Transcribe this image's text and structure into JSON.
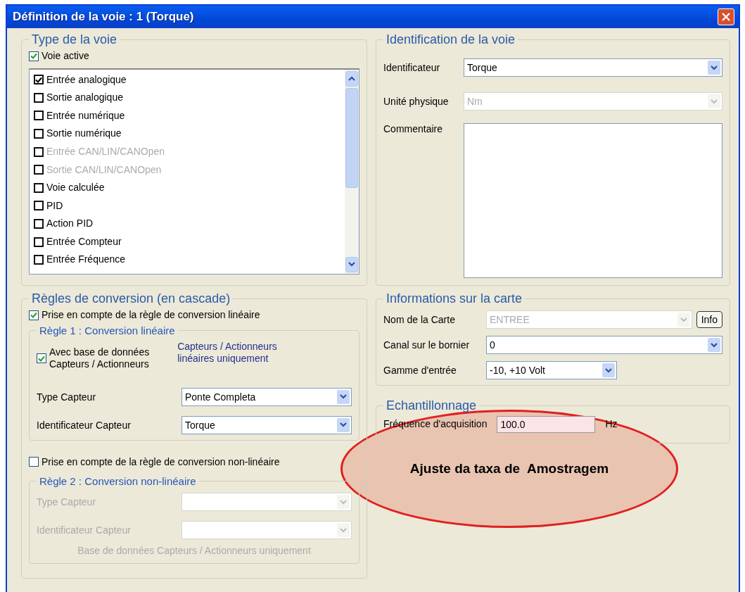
{
  "window": {
    "title": "Définition de la voie : 1 (Torque)"
  },
  "channel_type": {
    "title": "Type de la voie",
    "active": {
      "label": "Voie active",
      "checked": true
    },
    "types": [
      {
        "label": "Entrée analogique",
        "checked": true,
        "disabled": false
      },
      {
        "label": "Sortie analogique",
        "checked": false,
        "disabled": false
      },
      {
        "label": "Entrée numérique",
        "checked": false,
        "disabled": false
      },
      {
        "label": "Sortie numérique",
        "checked": false,
        "disabled": false
      },
      {
        "label": "Entrée CAN/LIN/CANOpen",
        "checked": false,
        "disabled": true
      },
      {
        "label": "Sortie CAN/LIN/CANOpen",
        "checked": false,
        "disabled": true
      },
      {
        "label": "Voie calculée",
        "checked": false,
        "disabled": false
      },
      {
        "label": "PID",
        "checked": false,
        "disabled": false
      },
      {
        "label": "Action PID",
        "checked": false,
        "disabled": false
      },
      {
        "label": "Entrée Compteur",
        "checked": false,
        "disabled": false
      },
      {
        "label": "Entrée Fréquence",
        "checked": false,
        "disabled": false
      }
    ]
  },
  "conversion": {
    "title": "Règles de conversion (en cascade)",
    "linear": {
      "label": "Prise en compte de la règle de conversion linéaire",
      "checked": true
    },
    "rule1": {
      "title": "Règle 1 : Conversion linéaire",
      "database": {
        "label": "Avec base de données\nCapteurs / Actionneurs",
        "checked": true
      },
      "note": "Capteurs / Actionneurs\nlinéaires uniquement",
      "fields": [
        {
          "label": "Type Capteur",
          "value": "Ponte Completa"
        },
        {
          "label": "Identificateur Capteur",
          "value": "Torque"
        }
      ],
      "disabled": false
    },
    "nonlinear": {
      "label": "Prise en compte de la règle de conversion non-linéaire",
      "checked": false
    },
    "rule2": {
      "title": "Règle 2 : Conversion non-linéaire",
      "fields": [
        {
          "label": "Type Capteur"
        },
        {
          "label": "Identificateur Capteur"
        }
      ],
      "note": "Base de données Capteurs / Actionneurs uniquement",
      "disabled": true
    }
  },
  "identification": {
    "title": "Identification de la voie",
    "fields": [
      {
        "label": "Identificateur",
        "value": "Torque",
        "disabled": false
      },
      {
        "label": "Unité physique",
        "value": "Nm",
        "disabled": true
      }
    ],
    "comment": {
      "label": "Commentaire"
    }
  },
  "card": {
    "title": "Informations sur la carte",
    "board": {
      "label": "Nom de la Carte",
      "value": "ENTREE",
      "disabled": true,
      "button": "Info"
    },
    "channel": {
      "label": "Canal sur le bornier",
      "value": "0",
      "disabled": false
    },
    "range": {
      "label": "Gamme d'entrée",
      "value": "-10, +10 Volt",
      "disabled": false
    }
  },
  "sampling": {
    "title": "Echantillonnage",
    "label": "Fréquence d'acquisition",
    "value": "100.0",
    "unit": "Hz"
  },
  "annotation": {
    "text": "Ajuste da taxa de  Amostragem"
  }
}
